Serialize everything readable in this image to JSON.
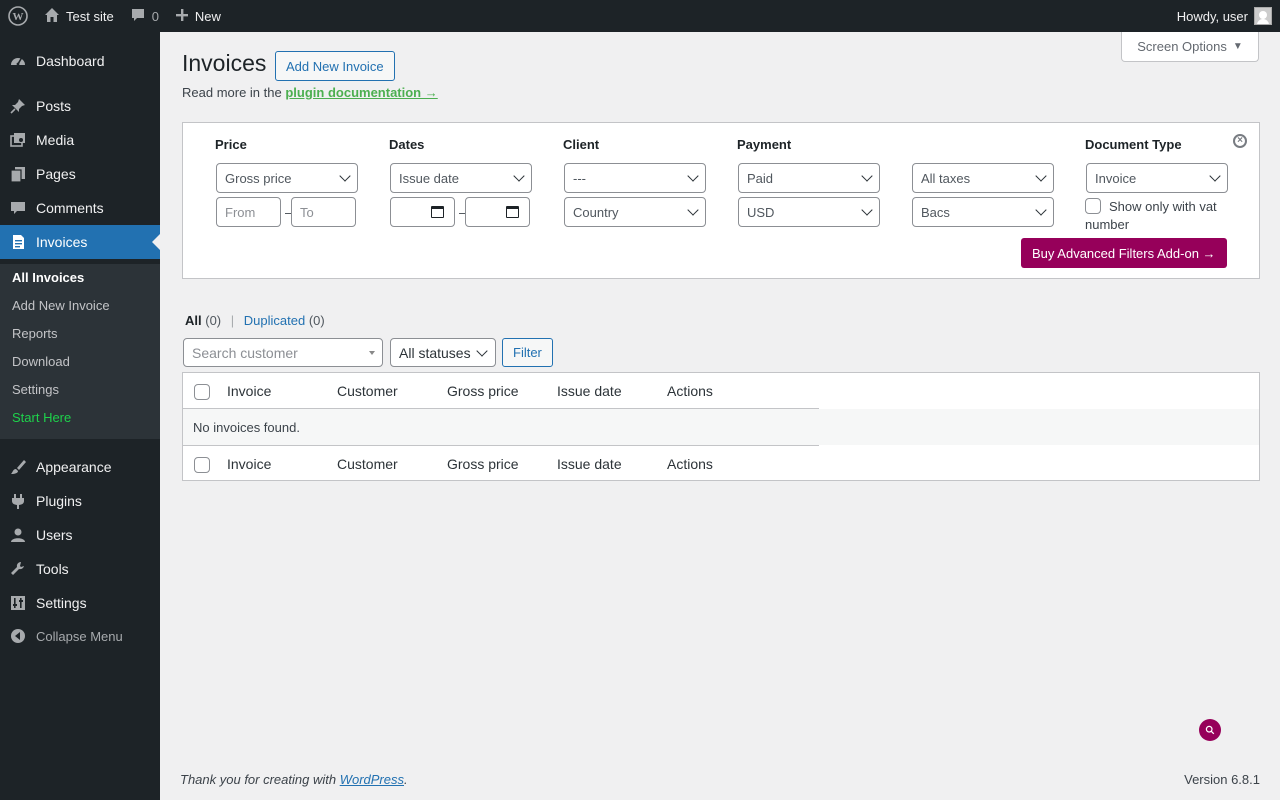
{
  "adminbar": {
    "site_name": "Test site",
    "comments_count": "0",
    "new_label": "New",
    "howdy": "Howdy, user"
  },
  "sidebar": {
    "items": [
      {
        "label": "Dashboard",
        "icon": "dashboard-icon"
      },
      {
        "label": "Posts",
        "icon": "pin-icon"
      },
      {
        "label": "Media",
        "icon": "media-icon"
      },
      {
        "label": "Pages",
        "icon": "pages-icon"
      },
      {
        "label": "Comments",
        "icon": "comment-icon"
      },
      {
        "label": "Invoices",
        "icon": "invoice-icon",
        "current": true
      },
      {
        "label": "Appearance",
        "icon": "brush-icon"
      },
      {
        "label": "Plugins",
        "icon": "plug-icon"
      },
      {
        "label": "Users",
        "icon": "user-icon"
      },
      {
        "label": "Tools",
        "icon": "wrench-icon"
      },
      {
        "label": "Settings",
        "icon": "settings-icon"
      }
    ],
    "submenu": [
      "All Invoices",
      "Add New Invoice",
      "Reports",
      "Download",
      "Settings",
      "Start Here"
    ],
    "collapse_label": "Collapse Menu"
  },
  "header": {
    "screen_options": "Screen Options",
    "title": "Invoices",
    "add_new": "Add New Invoice",
    "readmore_prefix": "Read more in the",
    "readmore_link": "plugin documentation →"
  },
  "filters": {
    "labels": {
      "price": "Price",
      "dates": "Dates",
      "client": "Client",
      "payment": "Payment",
      "document_type": "Document Type"
    },
    "price_type": "Gross price",
    "price_from_placeholder": "From",
    "price_to_placeholder": "To",
    "date_type": "Issue date",
    "client": "---",
    "country": "Country",
    "payment_status": "Paid",
    "currency": "USD",
    "taxes": "All taxes",
    "gateway": "Bacs",
    "document_type": "Invoice",
    "vat_only_label": "Show only with vat number",
    "buy_addon": "Buy Advanced Filters Add-on →",
    "separator": "–"
  },
  "views": {
    "all_label": "All",
    "all_count": "(0)",
    "separator": "|",
    "duplicated_label": "Duplicated",
    "duplicated_count": "(0)"
  },
  "toolbar": {
    "search_placeholder": "Search customer",
    "status": "All statuses",
    "filter": "Filter"
  },
  "table": {
    "columns": [
      "Invoice",
      "Customer",
      "Gross price",
      "Issue date",
      "Actions"
    ],
    "empty_message": "No invoices found."
  },
  "footer": {
    "thanks_prefix": "Thank you for creating with",
    "thanks_link": "WordPress",
    "thanks_suffix": ".",
    "version": "Version 6.8.1"
  },
  "colors": {
    "accent": "#2271b1",
    "addon_button": "#96005a",
    "admin_bg": "#1d2327",
    "doc_link": "#4caf50"
  }
}
